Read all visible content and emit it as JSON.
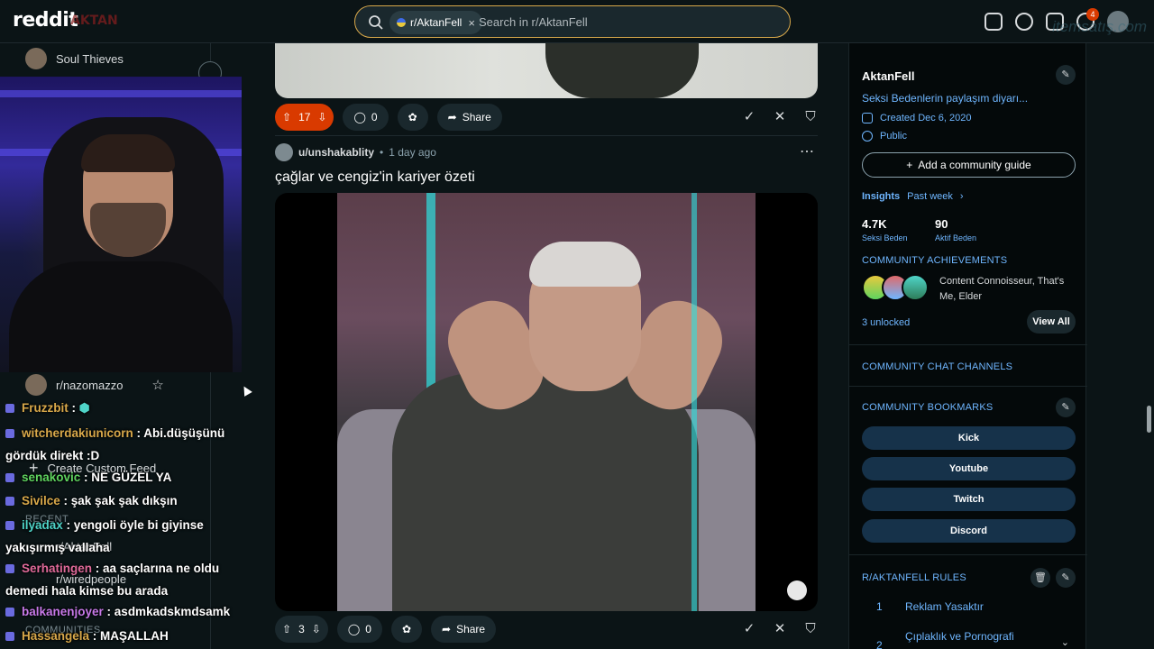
{
  "header": {
    "logo": "reddit",
    "logo_overlay": "AKTAN",
    "search_chip": "r/AktanFell",
    "search_placeholder": "Search in r/AktanFell",
    "notification_count": "4",
    "watermark": "itemsatış.com"
  },
  "leftbar": {
    "top_item": "Soul Thieves",
    "fav_item": "r/nazomazzo",
    "custom_feed": "Create Custom Feed",
    "recent_label": "RECENT",
    "recent_items": [
      "r/AktanFell",
      "r/wiredpeople"
    ],
    "communities_label": "COMMUNITIES"
  },
  "chat": [
    {
      "user": "Fruzzbit",
      "msg": "",
      "color": "#d8a84a"
    },
    {
      "user": "witcherdakiunicorn",
      "msg": "Abi.düşüşünü gördük direkt :D",
      "color": "#d8a84a"
    },
    {
      "user": "senakovic",
      "msg": "NE GÜZEL YA",
      "color": "#5fd45f"
    },
    {
      "user": "Sivilce",
      "msg": "şak şak şak dıkşın",
      "color": "#d8a84a"
    },
    {
      "user": "ilyadax",
      "msg": "yengoli öyle bi giyinse yakışırmış vallaha",
      "color": "#4fd4c8"
    },
    {
      "user": "Serhatingen",
      "msg": "aa saçlarına ne oldu demedi hala kimse bu arada",
      "color": "#e06a9a"
    },
    {
      "user": "balkanenjoyer",
      "msg": "asdmkadskmdsamk",
      "color": "#c779e8"
    },
    {
      "user": "Hassangela",
      "msg": "MAŞALLAH",
      "color": "#d8a84a"
    }
  ],
  "post1": {
    "upvotes": "17",
    "comments": "0",
    "share": "Share"
  },
  "post2": {
    "author": "u/unshakablity",
    "time": "1 day ago",
    "title": "çağlar ve cengiz'in kariyer özeti",
    "upvotes": "3",
    "comments": "0",
    "share": "Share"
  },
  "rightbar": {
    "community": "AktanFell",
    "description": "Seksi Bedenlerin paylaşım diyarı...",
    "created": "Created Dec 6, 2020",
    "visibility": "Public",
    "guide_button": "Add a community guide",
    "insights_label": "Insights",
    "insights_period": "Past week",
    "stat1_num": "4.7K",
    "stat1_cap": "Seksi Beden",
    "stat2_num": "90",
    "stat2_cap": "Aktif Beden",
    "achievements_title": "COMMUNITY ACHIEVEMENTS",
    "achievements_text": "Content Connoisseur, That's Me, Elder",
    "unlocked": "3 unlocked",
    "view_all": "View All",
    "chat_channels": "COMMUNITY CHAT CHANNELS",
    "bookmarks_title": "COMMUNITY BOOKMARKS",
    "bookmarks": [
      "Kick",
      "Youtube",
      "Twitch",
      "Discord"
    ],
    "rules_title": "R/AKTANFELL RULES",
    "rules": [
      {
        "num": "1",
        "text": "Reklam Yasaktır"
      },
      {
        "num": "2",
        "text": "Çıplaklık ve Pornografi"
      }
    ]
  }
}
